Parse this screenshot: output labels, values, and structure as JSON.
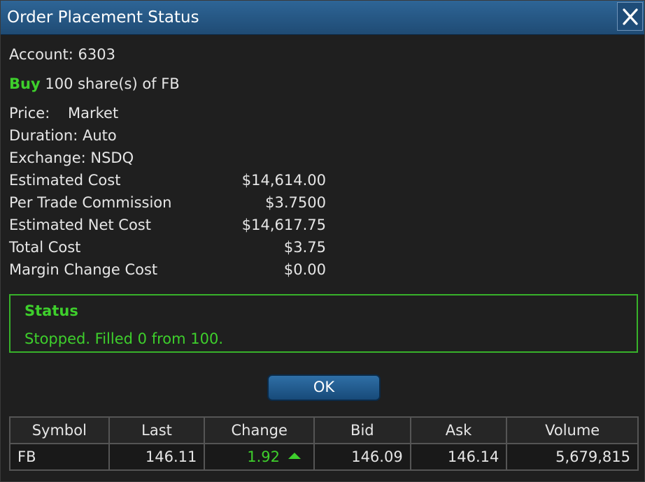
{
  "window": {
    "title": "Order Placement Status",
    "close_icon": "close-icon"
  },
  "order": {
    "account": "Account: 6303",
    "side": "Buy",
    "description": "100 share(s) of FB",
    "price_label": "Price:",
    "price_value": "Market",
    "duration": "Duration: Auto",
    "exchange": "Exchange: NSDQ"
  },
  "costs": [
    {
      "label": "Estimated Cost",
      "value": "$14,614.00"
    },
    {
      "label": "Per Trade Commission",
      "value": "$3.7500"
    },
    {
      "label": "Estimated Net Cost",
      "value": "$14,617.75"
    },
    {
      "label": "Total Cost",
      "value": "$3.75"
    },
    {
      "label": "Margin Change Cost",
      "value": "$0.00"
    }
  ],
  "status": {
    "heading": "Status",
    "message": "Stopped. Filled 0 from 100."
  },
  "ok_label": "OK",
  "quote_table": {
    "headers": [
      "Symbol",
      "Last",
      "Change",
      "Bid",
      "Ask",
      "Volume"
    ],
    "row": {
      "symbol": "FB",
      "last": "146.11",
      "change": "1.92",
      "change_direction_icon": "up-arrow-icon",
      "bid": "146.09",
      "ask": "146.14",
      "volume": "5,679,815"
    }
  },
  "colors": {
    "title_bar": "#2a5e8c",
    "positive": "#3ecf2c",
    "background": "#1f1f1f"
  }
}
